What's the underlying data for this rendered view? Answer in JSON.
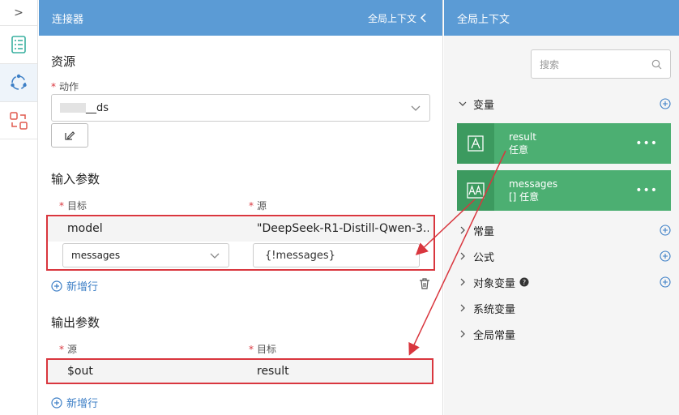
{
  "rail": {
    "toggle_glyph": ">"
  },
  "connector": {
    "title": "连接器",
    "context_link": "全局上下文",
    "resources_title": "资源",
    "action_label": "动作",
    "action_value": "__ds",
    "input_title": "输入参数",
    "input_col_target": "目标",
    "input_col_source": "源",
    "input_rows": [
      {
        "target": "model",
        "source": "\"DeepSeek-R1-Distill-Qwen-3..."
      },
      {
        "target": "messages",
        "source": "{!messages}"
      }
    ],
    "add_row": "新增行",
    "output_title": "输出参数",
    "output_col_source": "源",
    "output_col_target": "目标",
    "output_rows": [
      {
        "source": "$out",
        "target": "result"
      }
    ],
    "add_row_2": "新增行"
  },
  "context": {
    "title": "全局上下文",
    "search_placeholder": "搜索",
    "groups": {
      "variables": "变量",
      "constants": "常量",
      "formulas": "公式",
      "object_vars": "对象变量",
      "system_vars": "系统变量",
      "global_constants": "全局常量"
    },
    "variables": [
      {
        "name": "result",
        "type": "任意"
      },
      {
        "name": "messages",
        "type": "[] 任意"
      }
    ]
  },
  "colors": {
    "header": "#5b9bd5",
    "accent": "#3d7fc6",
    "var_card": "#4caf72",
    "highlight": "#d9363e"
  }
}
